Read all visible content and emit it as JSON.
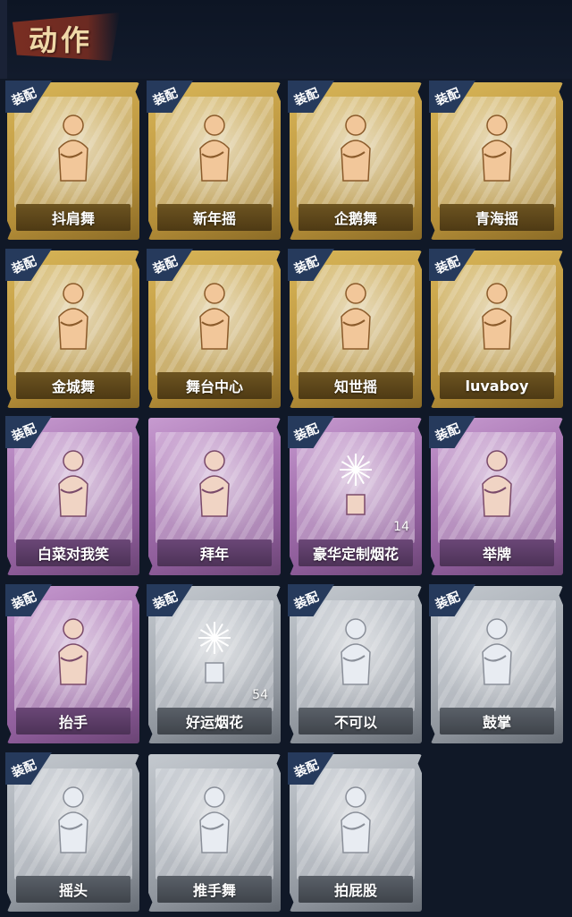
{
  "header": {
    "title": "动作"
  },
  "equip_label": "装配",
  "colors": {
    "gold": "#c9a44a",
    "purple": "#a673b1",
    "silver": "#a9afb6",
    "tag": "#263a5c",
    "background": "#101827"
  },
  "cards": [
    {
      "name": "抖肩舞",
      "rarity": "gold",
      "equipped": true,
      "icon": "shoulder-shake-figure-icon"
    },
    {
      "name": "新年摇",
      "rarity": "gold",
      "equipped": true,
      "icon": "new-year-sway-figure-icon"
    },
    {
      "name": "企鹅舞",
      "rarity": "gold",
      "equipped": true,
      "icon": "penguin-dance-figure-icon"
    },
    {
      "name": "青海摇",
      "rarity": "gold",
      "equipped": true,
      "icon": "qinghai-sway-figure-icon"
    },
    {
      "name": "金城舞",
      "rarity": "gold",
      "equipped": true,
      "icon": "jincheng-dance-figure-icon"
    },
    {
      "name": "舞台中心",
      "rarity": "gold",
      "equipped": true,
      "icon": "center-stage-figure-icon"
    },
    {
      "name": "知世摇",
      "rarity": "gold",
      "equipped": true,
      "icon": "zhishi-sway-figure-icon"
    },
    {
      "name": "luvaboy",
      "rarity": "gold",
      "equipped": true,
      "icon": "luvaboy-figure-icon"
    },
    {
      "name": "白菜对我笑",
      "rarity": "purple",
      "equipped": true,
      "icon": "cabbage-smile-figure-icon"
    },
    {
      "name": "拜年",
      "rarity": "purple",
      "equipped": false,
      "icon": "new-year-greeting-figure-icon"
    },
    {
      "name": "豪华定制烟花",
      "rarity": "purple",
      "equipped": true,
      "icon": "deluxe-fireworks-icon",
      "count": "14"
    },
    {
      "name": "举牌",
      "rarity": "purple",
      "equipped": true,
      "icon": "hold-sign-figure-icon"
    },
    {
      "name": "抬手",
      "rarity": "purple",
      "equipped": true,
      "icon": "raise-hand-figure-icon"
    },
    {
      "name": "好运烟花",
      "rarity": "silver",
      "equipped": true,
      "icon": "lucky-firework-icon",
      "count": "54"
    },
    {
      "name": "不可以",
      "rarity": "silver",
      "equipped": true,
      "icon": "no-finger-icon"
    },
    {
      "name": "鼓掌",
      "rarity": "silver",
      "equipped": true,
      "icon": "clapping-hands-icon"
    },
    {
      "name": "摇头",
      "rarity": "silver",
      "equipped": true,
      "icon": "head-shake-figure-icon"
    },
    {
      "name": "推手舞",
      "rarity": "silver",
      "equipped": false,
      "icon": "push-hand-dance-figure-icon"
    },
    {
      "name": "拍屁股",
      "rarity": "silver",
      "equipped": true,
      "icon": "butt-slap-figure-icon"
    }
  ]
}
